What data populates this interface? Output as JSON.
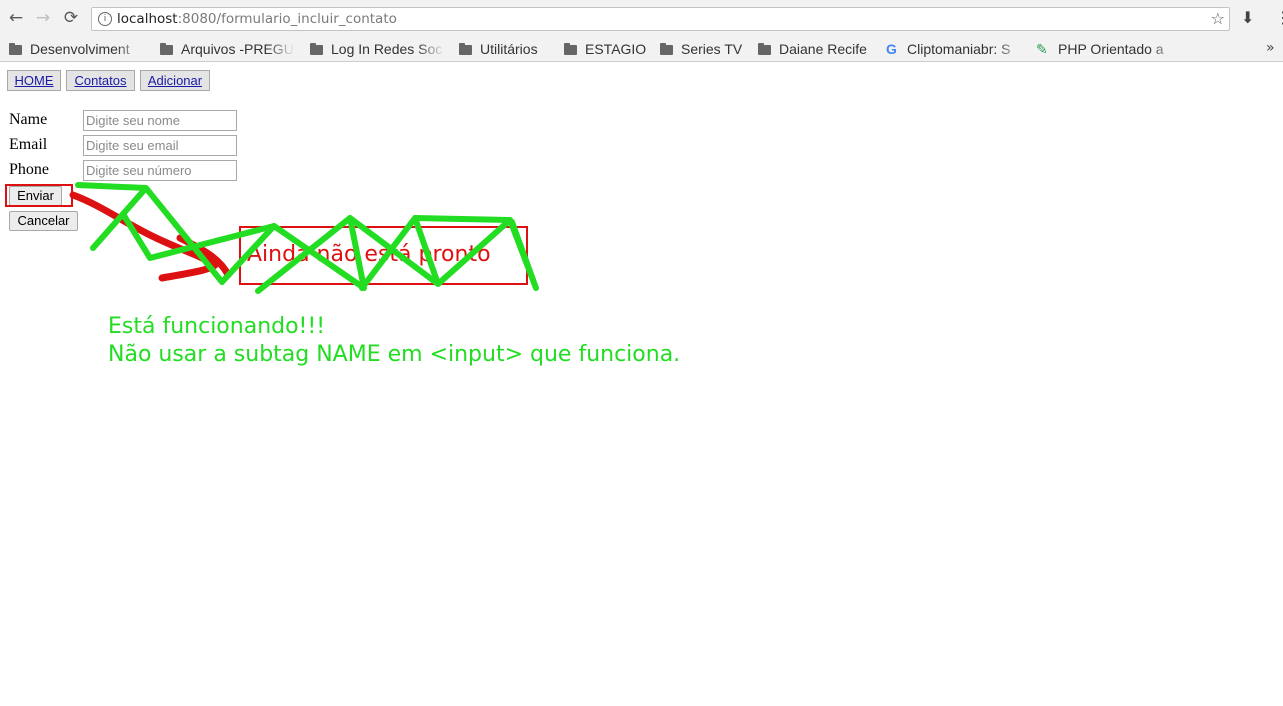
{
  "browser": {
    "url_host": "localhost",
    "url_rest": ":8080/formulario_incluir_contato",
    "back_icon": "←",
    "forward_icon": "→",
    "reload_icon": "⟳",
    "info_icon": "i",
    "star_icon": "☆",
    "download_icon": "⬇",
    "bookmarks_more_icon": "»",
    "bookmarks": [
      {
        "label": "Desenvolviment",
        "icon": "folder-icon"
      },
      {
        "label": "Arquivos -PREGU",
        "icon": "folder-icon"
      },
      {
        "label": "Log In Redes Soc",
        "icon": "folder-icon"
      },
      {
        "label": "Utilitários",
        "icon": "folder-icon"
      },
      {
        "label": "ESTAGIO",
        "icon": "folder-icon"
      },
      {
        "label": "Series TV",
        "icon": "folder-icon"
      },
      {
        "label": "Daiane Recife",
        "icon": "folder-icon"
      },
      {
        "label": "Cliptomaniabr: S",
        "icon": "google-icon"
      },
      {
        "label": "PHP Orientado a",
        "icon": "pen-icon"
      }
    ]
  },
  "nav": {
    "home": "HOME",
    "contatos": "Contatos",
    "adicionar": "Adicionar"
  },
  "form": {
    "name_label": "Name",
    "email_label": "Email",
    "phone_label": "Phone",
    "name_placeholder": "Digite seu nome",
    "email_placeholder": "Digite seu email",
    "phone_placeholder": "Digite seu número",
    "submit": "Enviar",
    "cancel": "Cancelar"
  },
  "annotation": {
    "red_message": "Ainda não está pronto",
    "green_line1": "Está funcionando!!!",
    "green_line2": "Não usar a subtag NAME em <input> que funciona.",
    "red_color": "#dd1111",
    "green_color": "#22dd22"
  }
}
